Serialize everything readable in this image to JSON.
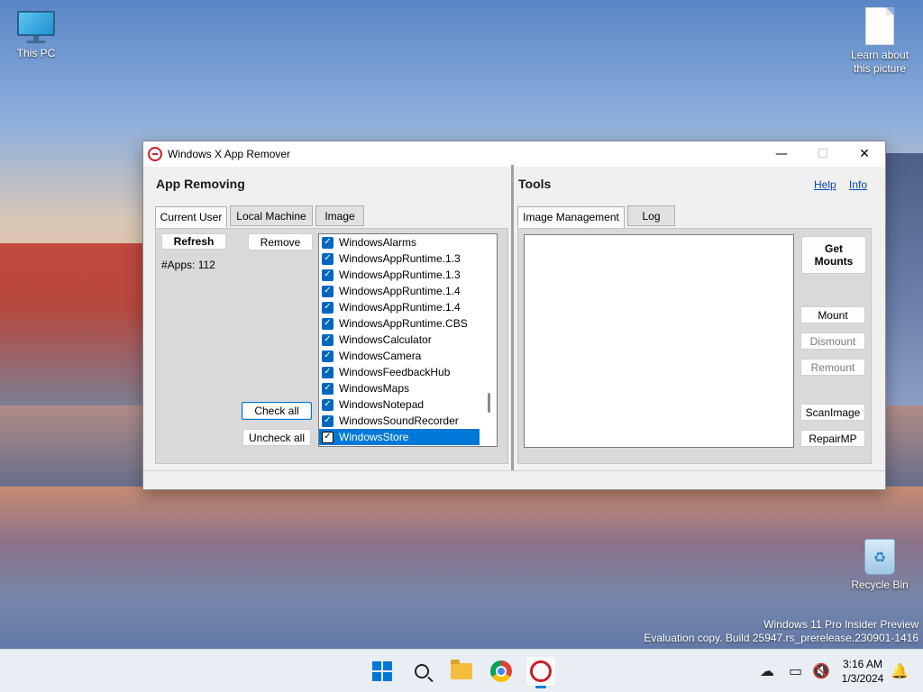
{
  "desktop": {
    "icons": {
      "this_pc": "This PC",
      "learn": "Learn about this picture",
      "recycle_bin": "Recycle Bin"
    },
    "watermark": {
      "line1": "Windows 11 Pro Insider Preview",
      "line2": "Evaluation copy. Build 25947.rs_prerelease.230901-1416"
    }
  },
  "window": {
    "title": "Windows X App Remover",
    "controls": {
      "minimize": "—",
      "maximize": "☐",
      "close": "✕"
    }
  },
  "app_removing": {
    "title": "App Removing",
    "tabs": [
      "Current User",
      "Local Machine",
      "Image"
    ],
    "active_tab": "Current User",
    "refresh_label": "Refresh",
    "remove_label": "Remove",
    "apps_count": "#Apps: 112",
    "check_all_label": "Check all",
    "uncheck_all_label": "Uncheck all",
    "apps": [
      {
        "name": "WindowsAlarms",
        "checked": true
      },
      {
        "name": "WindowsAppRuntime.1.3",
        "checked": true
      },
      {
        "name": "WindowsAppRuntime.1.3",
        "checked": true
      },
      {
        "name": "WindowsAppRuntime.1.4",
        "checked": true
      },
      {
        "name": "WindowsAppRuntime.1.4",
        "checked": true
      },
      {
        "name": "WindowsAppRuntime.CBS",
        "checked": true
      },
      {
        "name": "WindowsCalculator",
        "checked": true
      },
      {
        "name": "WindowsCamera",
        "checked": true
      },
      {
        "name": "WindowsFeedbackHub",
        "checked": true
      },
      {
        "name": "WindowsMaps",
        "checked": true
      },
      {
        "name": "WindowsNotepad",
        "checked": true
      },
      {
        "name": "WindowsSoundRecorder",
        "checked": true
      },
      {
        "name": "WindowsStore",
        "checked": true,
        "selected": true
      }
    ]
  },
  "tools": {
    "title": "Tools",
    "help_label": "Help",
    "info_label": "Info",
    "tabs": [
      "Image Management",
      "Log"
    ],
    "active_tab": "Image Management",
    "get_mounts_label": "Get Mounts",
    "mount_label": "Mount",
    "dismount_label": "Dismount",
    "remount_label": "Remount",
    "scanimage_label": "ScanImage",
    "repairmp_label": "RepairMP"
  },
  "taskbar": {
    "time": "3:16 AM",
    "date": "1/3/2024"
  },
  "colors": {
    "accent": "#0078d7",
    "link": "#0645ad",
    "selection": "#0078d7"
  }
}
